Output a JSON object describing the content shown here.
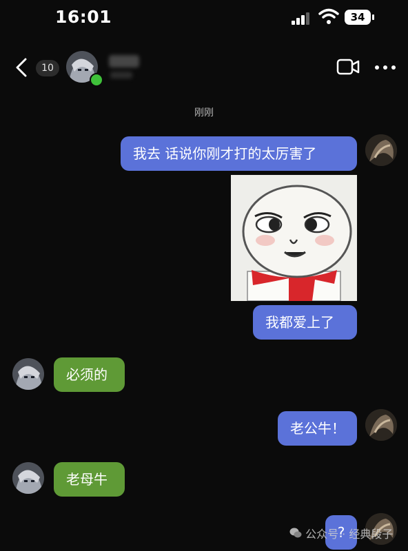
{
  "status_bar": {
    "time": "16:01",
    "battery": "34"
  },
  "header": {
    "unread_count": "10"
  },
  "chat": {
    "timestamp": "刚刚",
    "messages": [
      {
        "side": "right",
        "type": "text",
        "text": "我去 话说你刚才打的太厉害了"
      },
      {
        "side": "right",
        "type": "sticker",
        "icon": "meme-face-sticker"
      },
      {
        "side": "right",
        "type": "text",
        "text": "我都爱上了"
      },
      {
        "side": "left",
        "type": "text",
        "text": "必须的"
      },
      {
        "side": "right",
        "type": "text",
        "text": "老公牛！"
      },
      {
        "side": "left",
        "type": "text",
        "text": "老母牛"
      },
      {
        "side": "right",
        "type": "text",
        "text": "?"
      }
    ]
  },
  "watermark": {
    "text": "公众号 · 经典段子"
  },
  "colors": {
    "outgoing": "#5b72d9",
    "incoming": "#5f9a36",
    "background": "#0b0b0b",
    "online": "#3fc13a"
  }
}
